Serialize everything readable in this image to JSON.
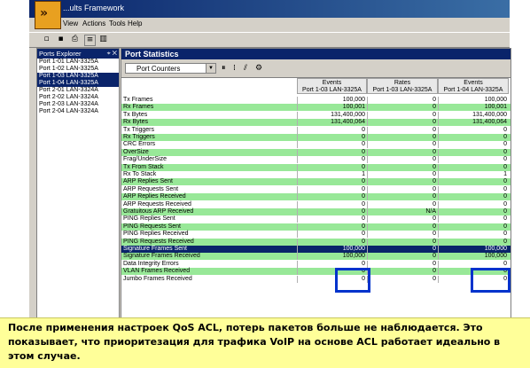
{
  "window": {
    "title": "...ults Framework"
  },
  "menu": [
    "View",
    "Actions",
    "Tools",
    "Help"
  ],
  "explorer": {
    "title": "Ports Explorer",
    "items": [
      {
        "label": "Port 1-01 LAN-3325A",
        "selected": false
      },
      {
        "label": "Port 1-02 LAN-3325A",
        "selected": false
      },
      {
        "label": "Port 1-03 LAN-3325A",
        "selected": true
      },
      {
        "label": "Port 1-04 LAN-3325A",
        "selected": true
      },
      {
        "label": "Port 2-01 LAN-3324A",
        "selected": false
      },
      {
        "label": "Port 2-02 LAN-3324A",
        "selected": false
      },
      {
        "label": "Port 2-03 LAN-3324A",
        "selected": false
      },
      {
        "label": "Port 2-04 LAN-3324A",
        "selected": false
      }
    ]
  },
  "stats": {
    "title": "Port Statistics",
    "view_select": "Port Counters",
    "columns": [
      {
        "line1": "Events",
        "line2": "Port 1-03 LAN-3325A"
      },
      {
        "line1": "Rates",
        "line2": "Port 1-03 LAN-3325A"
      },
      {
        "line1": "Events",
        "line2": "Port 1-04 LAN-3325A"
      }
    ],
    "rows": [
      {
        "label": "Tx Frames",
        "v": [
          "100,000",
          "0",
          "100,000"
        ],
        "style": "w"
      },
      {
        "label": "Rx Frames",
        "v": [
          "100,001",
          "0",
          "100,001"
        ],
        "style": "g"
      },
      {
        "label": "Tx Bytes",
        "v": [
          "131,400,000",
          "0",
          "131,400,000"
        ],
        "style": "w"
      },
      {
        "label": "Rx Bytes",
        "v": [
          "131,400,064",
          "0",
          "131,400,064"
        ],
        "style": "g"
      },
      {
        "label": "Tx Triggers",
        "v": [
          "0",
          "0",
          "0"
        ],
        "style": "w"
      },
      {
        "label": "Rx Triggers",
        "v": [
          "0",
          "0",
          "0"
        ],
        "style": "g"
      },
      {
        "label": "CRC Errors",
        "v": [
          "0",
          "0",
          "0"
        ],
        "style": "w"
      },
      {
        "label": "OverSize",
        "v": [
          "0",
          "0",
          "0"
        ],
        "style": "g"
      },
      {
        "label": "Frag/UnderSize",
        "v": [
          "0",
          "0",
          "0"
        ],
        "style": "w"
      },
      {
        "label": "Tx From Stack",
        "v": [
          "0",
          "0",
          "0"
        ],
        "style": "g"
      },
      {
        "label": "Rx To Stack",
        "v": [
          "1",
          "0",
          "1"
        ],
        "style": "w"
      },
      {
        "label": "ARP Replies Sent",
        "v": [
          "0",
          "0",
          "0"
        ],
        "style": "g"
      },
      {
        "label": "ARP Requests Sent",
        "v": [
          "0",
          "0",
          "0"
        ],
        "style": "w"
      },
      {
        "label": "ARP Replies Received",
        "v": [
          "0",
          "0",
          "0"
        ],
        "style": "g"
      },
      {
        "label": "ARP Requests Received",
        "v": [
          "0",
          "0",
          "0"
        ],
        "style": "w"
      },
      {
        "label": "Gratuitous ARP Received",
        "v": [
          "0",
          "N/A",
          "0"
        ],
        "style": "g"
      },
      {
        "label": "PING Replies Sent",
        "v": [
          "0",
          "0",
          "0"
        ],
        "style": "w"
      },
      {
        "label": "PING Requests Sent",
        "v": [
          "0",
          "0",
          "0"
        ],
        "style": "g"
      },
      {
        "label": "PING Replies Received",
        "v": [
          "0",
          "0",
          "0"
        ],
        "style": "w"
      },
      {
        "label": "PING Requests Received",
        "v": [
          "0",
          "0",
          "0"
        ],
        "style": "g"
      },
      {
        "label": "Signature Frames Sent",
        "v": [
          "100,000",
          "0",
          "100,000"
        ],
        "style": "sel"
      },
      {
        "label": "Signature Frames Received",
        "v": [
          "100,000",
          "0",
          "100,000"
        ],
        "style": "g"
      },
      {
        "label": "Data Integrity Errors",
        "v": [
          "0",
          "0",
          "0"
        ],
        "style": "w"
      },
      {
        "label": "VLAN Frames Received",
        "v": [
          "0",
          "0",
          "0"
        ],
        "style": "g"
      },
      {
        "label": "Jumbo Frames Received",
        "v": [
          "0",
          "0",
          "0"
        ],
        "style": "w"
      }
    ]
  },
  "caption": "После применения настроек QoS ACL, потерь пакетов больше не наблюдается. Это показывает, что приоритезация для трафика VoIP на основе ACL работает идеально в этом случае.",
  "colors": {
    "highlight": "#0033cc",
    "row_green": "#98e898",
    "selection": "#0a246a",
    "caption_bg": "#ffff99"
  }
}
